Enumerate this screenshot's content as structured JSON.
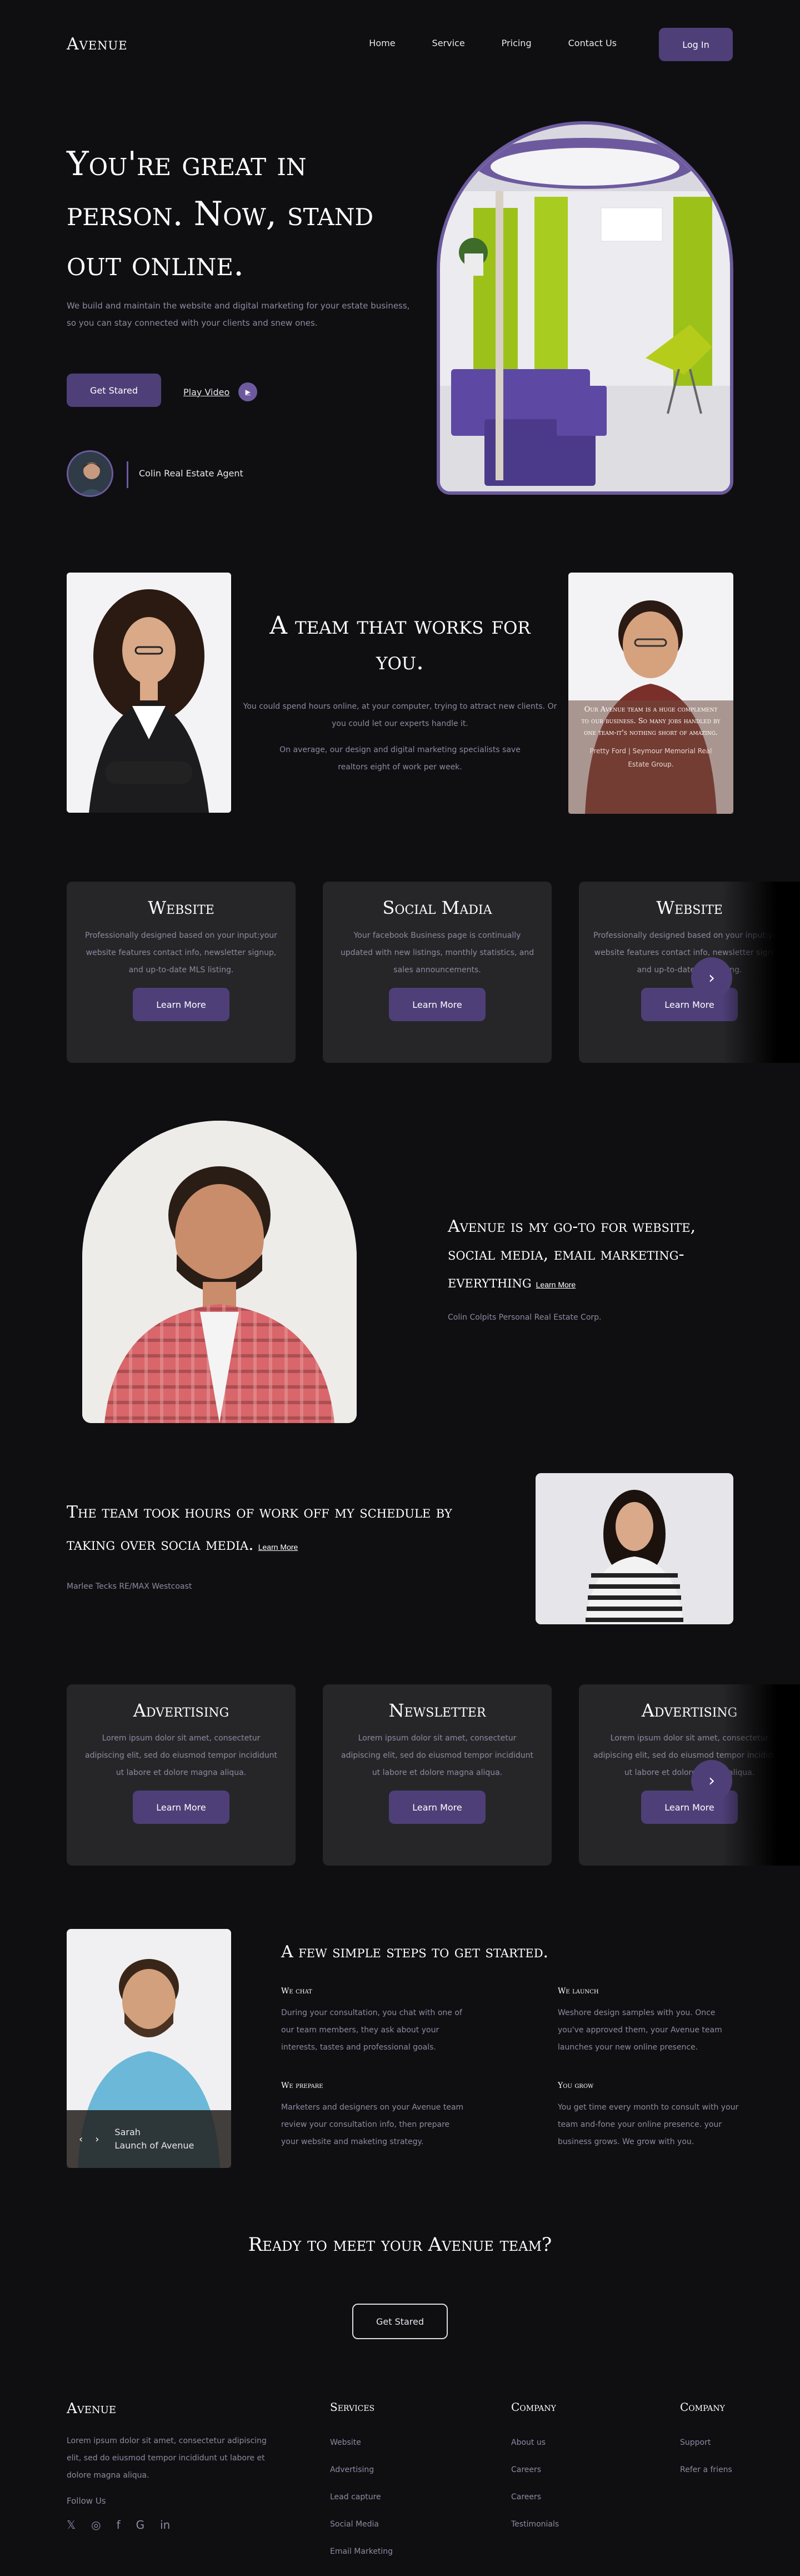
{
  "nav": {
    "logo": "Avenue",
    "items": [
      "Home",
      "Service",
      "Pricing",
      "Contact Us"
    ],
    "login": "Log In"
  },
  "hero": {
    "title": "You're great in person. Now, stand out online.",
    "desc": "We build and maintain the website and digital marketing for your estate business, so you can stay connected with your clients and snew ones.",
    "start": "Get Stared",
    "play": "Play Video",
    "agent": "Colin Real Estate Agent"
  },
  "team": {
    "title": "A team that works for you.",
    "p1": "You could spend hours online, at your computer, trying to attract new clients. Or you could let our experts handle it.",
    "p2": "On average, our design and digital marketing specialists save realtors eight of work per week.",
    "quote": "Our Avenue team is a huge complement to our business. So many jobs handled by one team-it's nothing short of amazing.",
    "quote_by": "Pretty Ford | Seymour Memorial Real Estate Group."
  },
  "cards1": [
    {
      "title": "Website",
      "desc": "Professionally designed based on your input:your website features contact info, newsletter signup, and up-to-date MLS listing.",
      "btn": "Learn More"
    },
    {
      "title": "Social Madia",
      "desc": "Your facebook Business page is continually updated with new listings, monthly statistics, and sales announcements.",
      "btn": "Learn More"
    },
    {
      "title": "Website",
      "desc": "Professionally designed based on your input:your website features contact info, newsletter signup, and up-to-date MLS listing.",
      "btn": "Learn More"
    }
  ],
  "testimonial1": {
    "text": "Avenue is my go-to for website, social media, email marketing- everything",
    "more": "Learn More",
    "by": "Colin Colpits Personal Real Estate Corp."
  },
  "testimonial2": {
    "text": "The team took hours of work off my schedule by taking over socia media.",
    "more": "Learn More",
    "by": "Marlee Tecks RE/MAX Westcoast"
  },
  "cards2": [
    {
      "title": "Advertising",
      "desc": "Lorem ipsum dolor sit amet, consectetur adipiscing elit, sed do eiusmod tempor incididunt ut labore et dolore magna aliqua.",
      "btn": "Learn More"
    },
    {
      "title": "Newsletter",
      "desc": "Lorem ipsum dolor sit amet, consectetur adipiscing elit, sed do eiusmod tempor incididunt ut labore et dolore magna aliqua.",
      "btn": "Learn More"
    },
    {
      "title": "Advertising",
      "desc": "Lorem ipsum dolor sit amet, consectetur adipiscing elit, sed do eiusmod tempor incididunt ut labore et dolore magna aliqua.",
      "btn": "Learn More"
    }
  ],
  "steps": {
    "title": "A few simple steps to get started.",
    "items": [
      {
        "h": "We chat",
        "p": "During your consultation, you chat with one of our team members, they ask about your interests, tastes and professional goals."
      },
      {
        "h": "We launch",
        "p": "Weshore design samples with you. Once you've approved them, your Avenue team launches your new online presence."
      },
      {
        "h": "We prepare",
        "p": "Marketers and designers on your Avenue team review your consultation info, then prepare your website and maketing strategy."
      },
      {
        "h": "You grow",
        "p": "You get time every month to consult with your team and-fone your online presence. your business grows. We grow with you."
      }
    ],
    "person_name": "Sarah",
    "person_role": "Launch of Avenue"
  },
  "ready": {
    "title": "Ready to meet your Avenue team?",
    "btn": "Get Stared"
  },
  "footer": {
    "logo": "Avenue",
    "desc": "Lorem ipsum dolor sit amet, consectetur adipiscing elit, sed do eiusmod tempor incididunt ut labore et dolore magna aliqua.",
    "follow": "Follow Us",
    "services_title": "Services",
    "services": [
      "Website",
      "Advertising",
      "Lead capture",
      "Social Media",
      "Email Marketing"
    ],
    "company_title": "Company",
    "company": [
      "About us",
      "Careers",
      "Careers",
      "Testimonials"
    ],
    "company2_title": "Company",
    "company2": [
      "Support",
      "Refer a friens"
    ]
  },
  "colors": {
    "accent": "#4e3f78",
    "accent_light": "#6d5a9e",
    "bg": "#0f0f12",
    "card": "#262629"
  },
  "icons": [
    "twitter-icon",
    "instagram-icon",
    "facebook-icon",
    "google-icon",
    "linkedin-icon",
    "chevron-right-icon",
    "play-icon"
  ]
}
